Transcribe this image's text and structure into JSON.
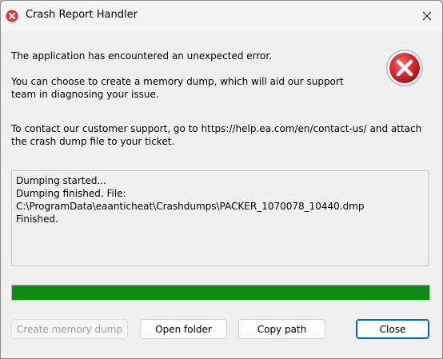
{
  "window": {
    "title": "Crash Report Handler",
    "close_glyph": "✕"
  },
  "icons": {
    "title_icon": "error-icon",
    "main_icon": "error-icon",
    "close_icon": "close-icon"
  },
  "message": {
    "line1": "The application has encountered an unexpected error.",
    "line2a": "You can choose to create a memory dump, which will aid our support",
    "line2b": "team in diagnosing your issue.",
    "line3a": "To contact our customer support, go to https://help.ea.com/en/contact-us/ and attach",
    "line3b": "the crash dump file to your ticket."
  },
  "log": {
    "lines": [
      "Dumping started...",
      "Dumping finished. File:",
      "C:\\ProgramData\\eaanticheat\\Crashdumps\\PACKER_1070078_10440.dmp",
      "Finished."
    ]
  },
  "progress": {
    "value_percent": 100,
    "fill_color": "#0f8a12"
  },
  "buttons": {
    "create_dump": "Create memory dump",
    "open_folder": "Open folder",
    "copy_path": "Copy path",
    "close": "Close"
  },
  "colors": {
    "error_red": "#d9262c",
    "accent_blue": "#0067c0"
  }
}
